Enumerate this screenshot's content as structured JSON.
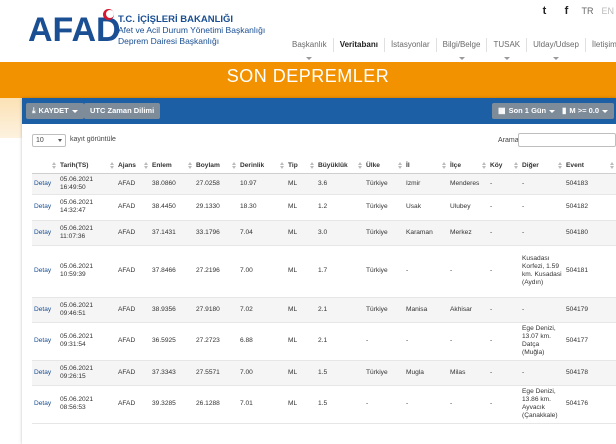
{
  "header": {
    "logo_text": "AFAD",
    "org_line1": "T.C. İÇİŞLERİ BAKANLIĞI",
    "org_line2": "Afet ve Acil Durum Yönetimi Başkanlığı",
    "org_line3": "Deprem Dairesi Başkanlığı",
    "social": {
      "twitter": "t",
      "facebook": "f"
    },
    "lang_tr": "TR",
    "lang_en": "EN",
    "nav": [
      {
        "label": "Başkanlık",
        "active": false,
        "caret": true
      },
      {
        "label": "Veritabanı",
        "active": true,
        "caret": false
      },
      {
        "label": "İstasyonlar",
        "active": false,
        "caret": false
      },
      {
        "label": "Bilgi/Belge",
        "active": false,
        "caret": true
      },
      {
        "label": "TUSAK",
        "active": false,
        "caret": true
      },
      {
        "label": "Ulday/Udsep",
        "active": false,
        "caret": true
      },
      {
        "label": "İletişim",
        "active": false,
        "caret": false
      }
    ]
  },
  "banner": {
    "title": "SON DEPREMLER"
  },
  "toolbar": {
    "save_label": "KAYDET",
    "utc_label": "UTC Zaman Dilimi",
    "period_label": "Son 1 Gün",
    "magnitude_label": "M >= 0.0"
  },
  "controls": {
    "per_page_value": "10",
    "per_page_label": "kayıt görüntüle",
    "search_label": "Arama:",
    "search_value": ""
  },
  "table": {
    "columns": [
      "",
      "Tarih(TS)",
      "Ajans",
      "Enlem",
      "Boylam",
      "Derinlik",
      "Tip",
      "Büyüklük",
      "Ülke",
      "İl",
      "İlçe",
      "Köy",
      "Diğer",
      "Event"
    ],
    "rows": [
      [
        "Detay",
        "05.06.2021 16:49:50",
        "AFAD",
        "38.0860",
        "27.0258",
        "10.97",
        "ML",
        "3.6",
        "Türkiye",
        "Izmir",
        "Menderes",
        "-",
        "-",
        "504183"
      ],
      [
        "Detay",
        "05.06.2021 14:32:47",
        "AFAD",
        "38.4450",
        "29.1330",
        "18.30",
        "ML",
        "1.2",
        "Türkiye",
        "Usak",
        "Ulubey",
        "-",
        "-",
        "504182"
      ],
      [
        "Detay",
        "05.06.2021 11:07:36",
        "AFAD",
        "37.1431",
        "33.1796",
        "7.04",
        "ML",
        "3.0",
        "Türkiye",
        "Karaman",
        "Merkez",
        "-",
        "-",
        "504180"
      ],
      [
        "Detay",
        "05.06.2021 10:59:39",
        "AFAD",
        "37.8466",
        "27.2196",
        "7.00",
        "ML",
        "1.7",
        "Türkiye",
        "-",
        "-",
        "-",
        "Kusadası Korfezi, 1.59 km. Kusadasi (Aydın)",
        "504181"
      ],
      [
        "Detay",
        "05.06.2021 09:46:51",
        "AFAD",
        "38.9356",
        "27.9180",
        "7.02",
        "ML",
        "2.1",
        "Türkiye",
        "Manisa",
        "Akhisar",
        "-",
        "-",
        "504179"
      ],
      [
        "Detay",
        "05.06.2021 09:31:54",
        "AFAD",
        "36.5925",
        "27.2723",
        "6.88",
        "ML",
        "2.1",
        "-",
        "-",
        "-",
        "-",
        "Ege Denizi, 13.07 km. Datça (Muğla)",
        "504177"
      ],
      [
        "Detay",
        "05.06.2021 09:26:15",
        "AFAD",
        "37.3343",
        "27.5571",
        "7.00",
        "ML",
        "1.5",
        "Türkiye",
        "Mugla",
        "Milas",
        "-",
        "-",
        "504178"
      ],
      [
        "Detay",
        "05.06.2021 08:56:53",
        "AFAD",
        "39.3285",
        "26.1288",
        "7.01",
        "ML",
        "1.5",
        "-",
        "-",
        "-",
        "-",
        "Ege Denizi, 13.86 km. Ayvacık (Çanakkale)",
        "504176"
      ]
    ]
  },
  "colors": {
    "brand_blue": "#1a4f93",
    "toolbar_blue": "#1c5fa5",
    "banner_orange": "#f39200",
    "logo_red": "#d7172f"
  }
}
